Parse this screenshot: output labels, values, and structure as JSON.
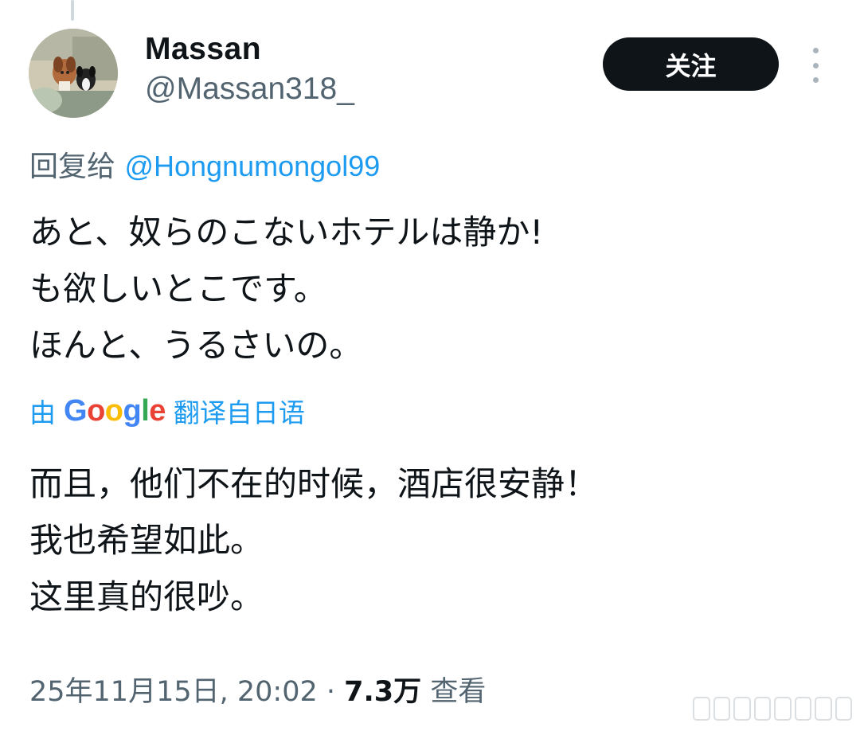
{
  "tweet": {
    "author": {
      "name": "Massan",
      "handle": "@Massan318_"
    },
    "follow_label": "关注",
    "reply_to": {
      "prefix": "回复给",
      "mention": "@Hongnumongol99"
    },
    "text_lines": [
      "あと、奴らのこないホテルは静か!",
      "も欲しいとこです。",
      "ほんと、うるさいの。"
    ],
    "translation": {
      "prefix": "由",
      "provider": "Google",
      "suffix": "翻译自日语",
      "lines": [
        "而且，他们不在的时候，酒店很安静！",
        "我也希望如此。",
        "这里真的很吵。"
      ]
    },
    "meta": {
      "timestamp": "25年11月15日, 20:02",
      "separator": "·",
      "views": "7.3万",
      "views_label": "查看"
    }
  },
  "colors": {
    "accent": "#1d9bf0",
    "text": "#0f1419",
    "secondary": "#536471",
    "button_bg": "#0f1419"
  },
  "icons": [
    "more-vertical-icon",
    "avatar-dogs-image"
  ]
}
